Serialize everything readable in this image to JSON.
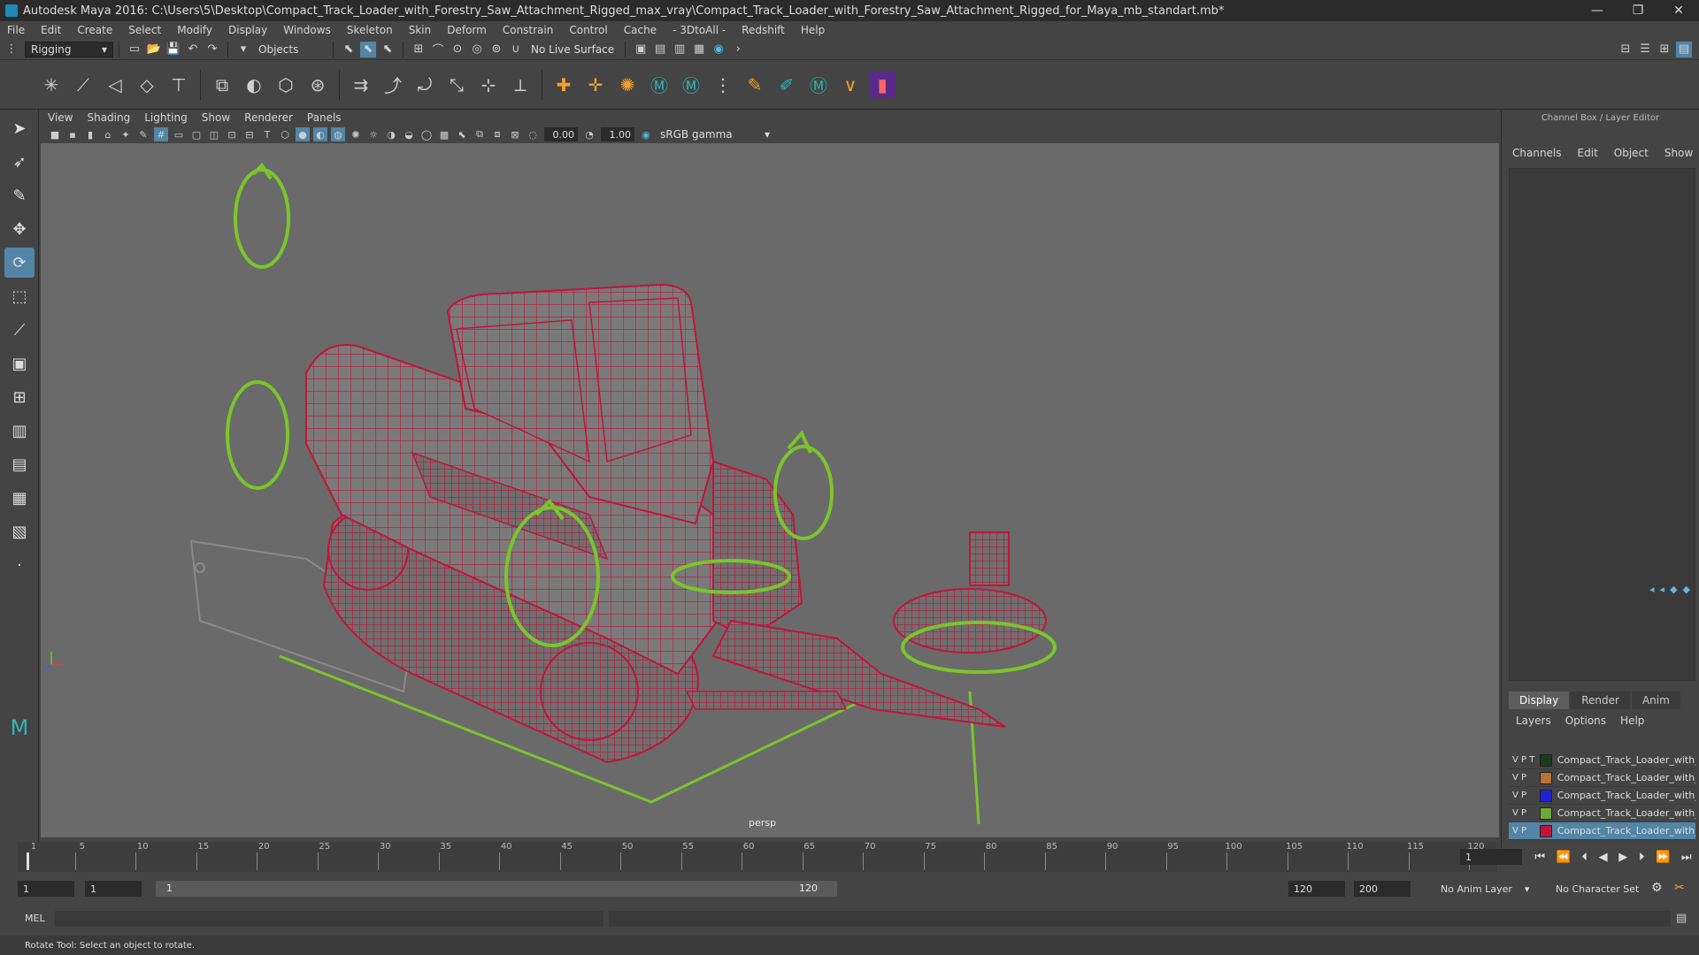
{
  "window": {
    "title": "Autodesk Maya 2016: C:\\Users\\5\\Desktop\\Compact_Track_Loader_with_Forestry_Saw_Attachment_Rigged_max_vray\\Compact_Track_Loader_with_Forestry_Saw_Attachment_Rigged_for_Maya_mb_standart.mb*",
    "minimize": "—",
    "maximize": "❐",
    "close": "✕"
  },
  "menubar": [
    "File",
    "Edit",
    "Create",
    "Select",
    "Modify",
    "Display",
    "Windows",
    "Skeleton",
    "Skin",
    "Deform",
    "Constrain",
    "Control",
    "Cache",
    "- 3DtoAll -",
    "Redshift",
    "Help"
  ],
  "statusline": {
    "menuset": "Rigging",
    "selection_mask": "Objects",
    "live_surface": "No Live Surface"
  },
  "viewport": {
    "menu": [
      "View",
      "Shading",
      "Lighting",
      "Show",
      "Renderer",
      "Panels"
    ],
    "exposure": "0.00",
    "gamma": "1.00",
    "color_space": "sRGB gamma",
    "camera": "persp"
  },
  "channelbox": {
    "title": "Channel Box / Layer Editor",
    "menu": [
      "Channels",
      "Edit",
      "Object",
      "Show"
    ],
    "layer_tabs": [
      "Display",
      "Render",
      "Anim"
    ],
    "layer_menu": [
      "Layers",
      "Options",
      "Help"
    ],
    "layers": [
      {
        "vis": "V",
        "play": "P",
        "type": "T",
        "color": "#1e3a1e",
        "name": "Compact_Track_Loader_with_"
      },
      {
        "vis": "V",
        "play": "P",
        "type": "",
        "color": "#b87333",
        "name": "Compact_Track_Loader_with_"
      },
      {
        "vis": "V",
        "play": "P",
        "type": "",
        "color": "#1f22d8",
        "name": "Compact_Track_Loader_with_"
      },
      {
        "vis": "V",
        "play": "P",
        "type": "",
        "color": "#6fa832",
        "name": "Compact_Track_Loader_with_"
      },
      {
        "vis": "V",
        "play": "P",
        "type": "",
        "color": "#c0143c",
        "name": "Compact_Track_Loader_with_"
      }
    ]
  },
  "timeslider": {
    "ticks": [
      "1",
      "5",
      "10",
      "15",
      "20",
      "25",
      "30",
      "35",
      "40",
      "45",
      "50",
      "55",
      "60",
      "65",
      "70",
      "75",
      "80",
      "85",
      "90",
      "95",
      "100",
      "105",
      "110",
      "115",
      "120"
    ],
    "current_frame": "1"
  },
  "range": {
    "start": "1",
    "playback_start": "1",
    "slider_start": "1",
    "slider_end": "120",
    "playback_end": "120",
    "end": "200",
    "anim_layer": "No Anim Layer",
    "character_set": "No Character Set"
  },
  "cmdline": {
    "label": "MEL"
  },
  "helpline": {
    "text": "Rotate Tool: Select an object to rotate."
  },
  "colors": {
    "wire": "#c0143c",
    "control": "#7bc52c",
    "accent": "#5285a6"
  }
}
